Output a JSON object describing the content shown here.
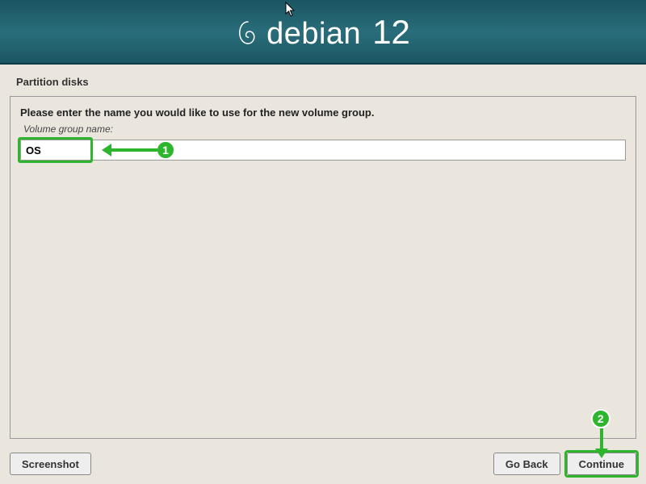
{
  "header": {
    "brand": "debian",
    "version": "12"
  },
  "section_title": "Partition disks",
  "panel": {
    "instruction": "Please enter the name you would like to use for the new volume group.",
    "field_label": "Volume group name:",
    "input_value": "OS"
  },
  "buttons": {
    "screenshot": "Screenshot",
    "goback": "Go Back",
    "continue": "Continue"
  },
  "annotations": {
    "badge1": "1",
    "badge2": "2"
  }
}
